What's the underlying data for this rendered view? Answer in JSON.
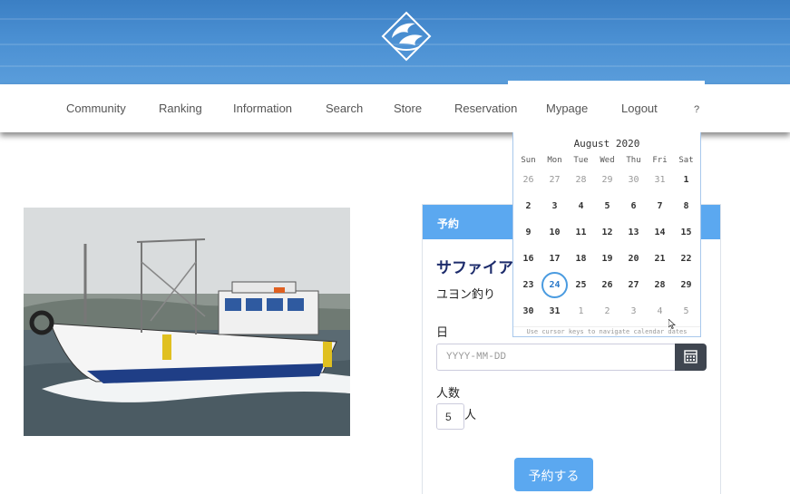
{
  "nav": {
    "items": [
      "Community",
      "Ranking",
      "Information",
      "Search",
      "Store",
      "Reservation",
      "Mypage",
      "Logout",
      "?"
    ]
  },
  "card": {
    "header": "予約",
    "boat_name": "サファイア",
    "boat_sub": "ユヨン釣り",
    "date_label": "日",
    "date_placeholder": "YYYY-MM-DD",
    "people_label": "人数",
    "people_value": "5",
    "people_unit": "人",
    "submit_label": "予約する"
  },
  "calendar": {
    "title": "August 2020",
    "weekdays": [
      "Sun",
      "Mon",
      "Tue",
      "Wed",
      "Thu",
      "Fri",
      "Sat"
    ],
    "weeks": [
      [
        "26",
        "27",
        "28",
        "29",
        "30",
        "31",
        "1"
      ],
      [
        "2",
        "3",
        "4",
        "5",
        "6",
        "7",
        "8"
      ],
      [
        "9",
        "10",
        "11",
        "12",
        "13",
        "14",
        "15"
      ],
      [
        "16",
        "17",
        "18",
        "19",
        "20",
        "21",
        "22"
      ],
      [
        "23",
        "24",
        "25",
        "26",
        "27",
        "28",
        "29"
      ],
      [
        "30",
        "31",
        "1",
        "2",
        "3",
        "4",
        "5"
      ]
    ],
    "today": "24",
    "hint": "Use cursor keys to navigate calendar dates"
  },
  "colors": {
    "accent": "#5ba8f0",
    "banner": "#4a8fd2",
    "title_navy": "#1c2b6b"
  },
  "icons": {
    "logo": "dolphin-logo-icon",
    "calendar_button": "calendar-icon"
  }
}
